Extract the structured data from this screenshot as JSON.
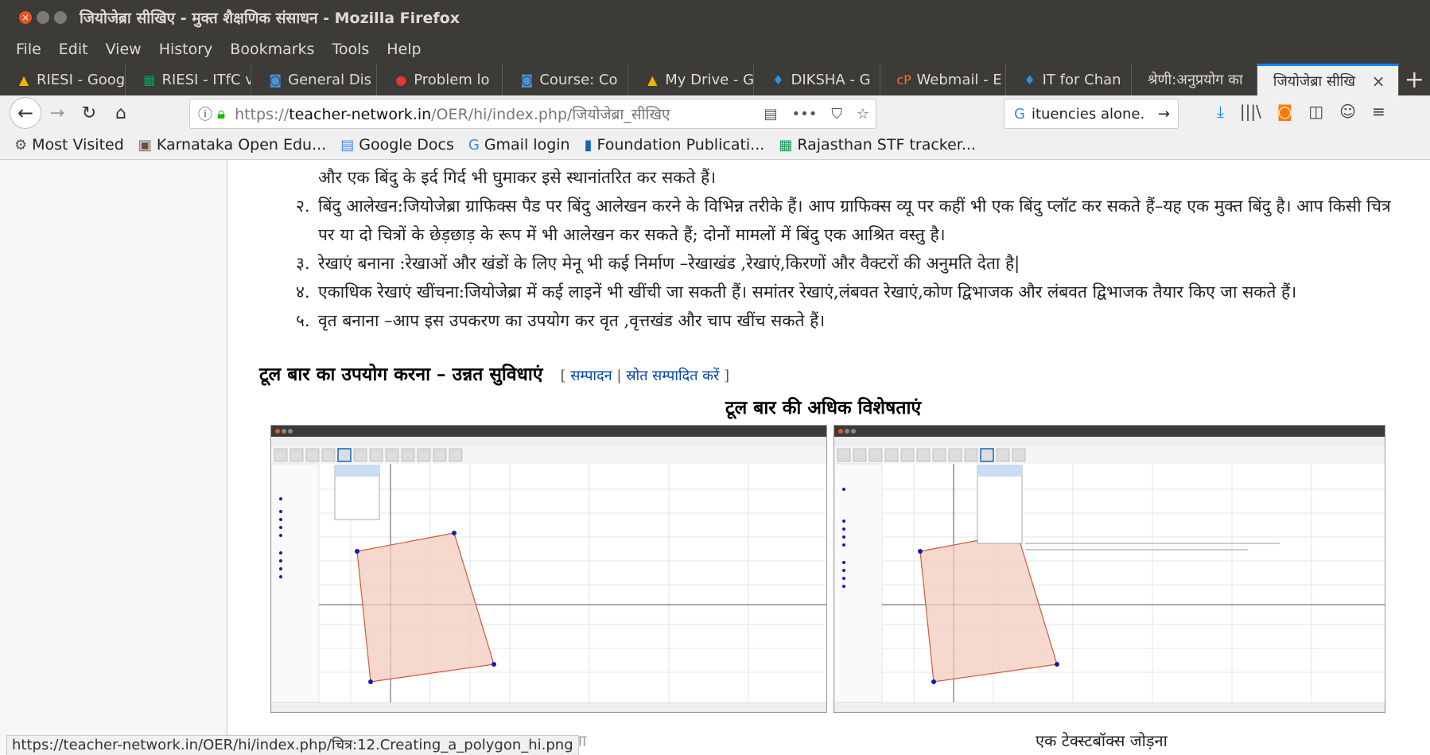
{
  "window": {
    "title": "जियोजेब्रा सीखिए - मुक्त शैक्षणिक संसाधन - Mozilla Firefox"
  },
  "menu": [
    "File",
    "Edit",
    "View",
    "History",
    "Bookmarks",
    "Tools",
    "Help"
  ],
  "tabs": [
    {
      "label": "RIESI - Goog",
      "icon": "drive-icon",
      "color": "#f4b400"
    },
    {
      "label": "RIESI - ITfC v",
      "icon": "sheets-icon",
      "color": "#0f9d58"
    },
    {
      "label": "General Dis",
      "icon": "moodle-icon",
      "color": "#4a90d9"
    },
    {
      "label": "Problem lo",
      "icon": "alert-icon",
      "color": "#e53935"
    },
    {
      "label": "Course: Co",
      "icon": "moodle-icon",
      "color": "#4a90d9"
    },
    {
      "label": "My Drive - G",
      "icon": "drive-icon",
      "color": "#f4b400"
    },
    {
      "label": "DIKSHA - G",
      "icon": "diksha-icon",
      "color": "#2196f3"
    },
    {
      "label": "Webmail - E",
      "icon": "cpanel-icon",
      "color": "#ff6c2c"
    },
    {
      "label": "IT for Chan",
      "icon": "diksha-icon",
      "color": "#2196f3"
    },
    {
      "label": "श्रेणी:अनुप्रयोग का",
      "icon": "",
      "color": ""
    },
    {
      "label": "जियोजेब्रा सीखि",
      "icon": "",
      "color": "",
      "active": true
    }
  ],
  "nav": {
    "url_prefix": "https://",
    "url_domain": "teacher-network.in",
    "url_path": "/OER/hi/index.php/जियोजेब्रा_सीखिए",
    "search_text": "ituencies alone."
  },
  "bookmarks": [
    {
      "label": "Most Visited",
      "icon": "gear-icon",
      "glyph": "⚙",
      "color": "#555"
    },
    {
      "label": "Karnataka Open Edu...",
      "icon": "koer-icon",
      "glyph": "▣",
      "color": "#6d4c41"
    },
    {
      "label": "Google Docs",
      "icon": "docs-icon",
      "glyph": "▤",
      "color": "#4285f4"
    },
    {
      "label": "Gmail login",
      "icon": "google-icon",
      "glyph": "G",
      "color": "#4285f4"
    },
    {
      "label": "Foundation Publicati...",
      "icon": "bookmark-icon",
      "glyph": "▮",
      "color": "#1565c0"
    },
    {
      "label": "Rajasthan STF tracker...",
      "icon": "sheets-icon",
      "glyph": "▦",
      "color": "#0f9d58"
    }
  ],
  "content": {
    "items": [
      {
        "num": "",
        "text": "और एक बिंदु के इर्द गिर्द भी घुमाकर इसे स्थानांतरित कर सकते हैं।"
      },
      {
        "num": "२.",
        "text": "बिंदु आलेखन:जियोजेब्रा ग्राफिक्स पैड पर बिंदु आलेखन करने के विभिन्न तरीके हैं। आप ग्राफिक्स व्यू पर कहीं भी एक बिंदु प्लॉट कर सकते हैं–यह एक मुक्त बिंदु है। आप किसी चित्र पर या दो चित्रों के छेड़छाड़ के रूप में भी आलेखन कर सकते हैं; दोनों मामलों में बिंदु एक आश्रित वस्तु है।"
      },
      {
        "num": "३.",
        "text": "रेखाएं बनाना :रेखाओं और खंडों के लिए मेनू भी कई निर्माण –रेखाखंड ,रेखाएं,किरणों और वैक्टरों की अनुमति देता है|"
      },
      {
        "num": "४.",
        "text": "एकाधिक रेखाएं खींचना:जियोजेब्रा में कई लाइनें भी खींची जा सकती हैं। समांतर रेखाएं,लंबवत रेखाएं,कोण द्विभाजक और लंबवत द्विभाजक तैयार किए जा सकते हैं।"
      },
      {
        "num": "५.",
        "text": "वृत बनाना –आप इस उपकरण का उपयोग कर वृत ,वृत्तखंड और चाप खींच सकते हैं।"
      }
    ],
    "section_heading": "टूल बार का उपयोग करना – उन्नत सुविधाएं",
    "edit_open": "[",
    "edit_link": "सम्पादन",
    "edit_sep": "|",
    "edit_source_link": "स्रोत सम्पादित करें",
    "edit_close": "]",
    "figure_title": "टूल बार की अधिक विशेषताएं",
    "caption_left": "बहुभुज बनाना",
    "caption_right": "एक टेक्स्टबॉक्स जोड़ना"
  },
  "status_url": "https://teacher-network.in/OER/hi/index.php/चित्र:12.Creating_a_polygon_hi.png"
}
